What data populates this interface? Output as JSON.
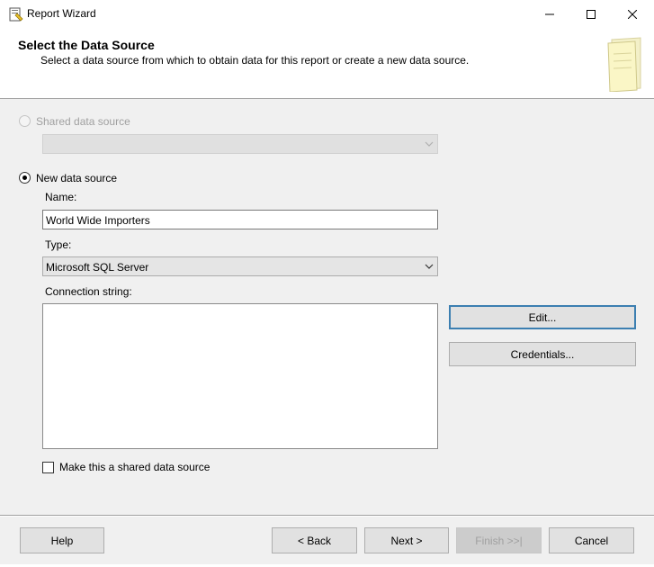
{
  "window": {
    "title": "Report Wizard"
  },
  "header": {
    "title": "Select the Data Source",
    "subtitle": "Select a data source from which to obtain data for this report or create a new data source."
  },
  "shared_source": {
    "label": "Shared data source",
    "selected_value": ""
  },
  "new_source": {
    "label": "New data source",
    "name_label": "Name:",
    "name_value": "World Wide Importers",
    "type_label": "Type:",
    "type_value": "Microsoft SQL Server",
    "connection_label": "Connection string:",
    "connection_value": "",
    "edit_label": "Edit...",
    "credentials_label": "Credentials...",
    "make_shared_label": "Make this a shared data source"
  },
  "footer": {
    "help_label": "Help",
    "back_label": "< Back",
    "next_label": "Next >",
    "finish_label": "Finish >>|",
    "cancel_label": "Cancel"
  },
  "icons": {
    "app": "report-wizard-icon",
    "minimize": "minimize-icon",
    "maximize": "maximize-icon",
    "close": "close-icon",
    "header_art": "wizard-notepad-icon",
    "dropdown": "chevron-down-icon"
  },
  "colors": {
    "default_button_border": "#3c7fb1",
    "disabled_text": "#a0a0a0"
  }
}
